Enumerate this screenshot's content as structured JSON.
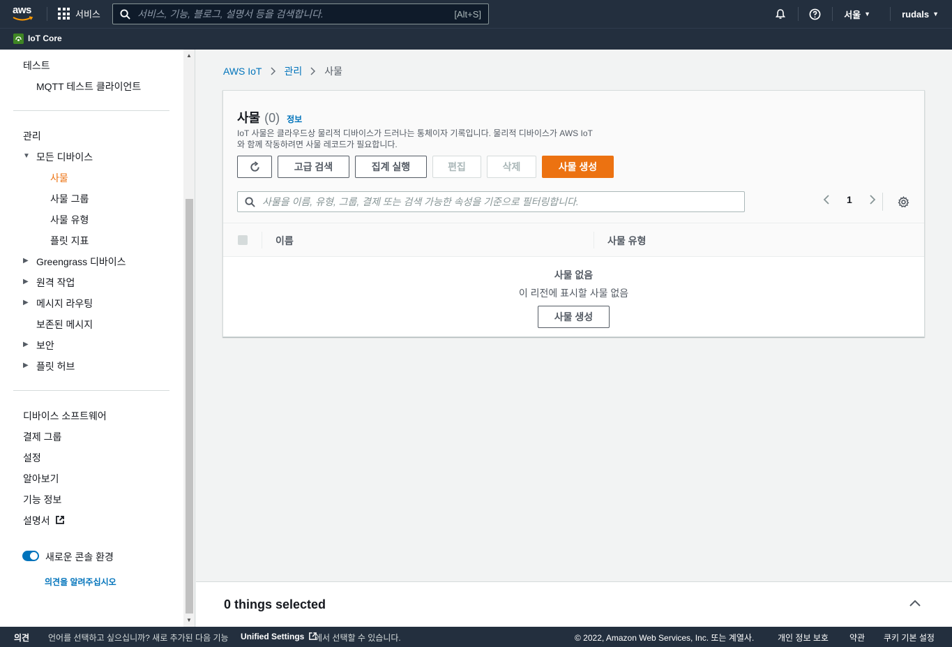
{
  "topnav": {
    "logo": "aws",
    "services_label": "서비스",
    "search_placeholder": "서비스, 기능, 블로그, 설명서 등을 검색합니다.",
    "search_shortcut": "[Alt+S]",
    "region": "서울",
    "user": "rudals"
  },
  "subnav": {
    "service": "IoT Core"
  },
  "sidebar": {
    "section_test": "테스트",
    "mqtt": "MQTT 테스트 클라이언트",
    "section_manage": "관리",
    "all_devices": "모든 디바이스",
    "things": "사물",
    "thing_groups": "사물 그룹",
    "thing_types": "사물 유형",
    "fleet_metrics": "플릿 지표",
    "greengrass": "Greengrass 디바이스",
    "remote": "원격 작업",
    "routing": "메시지 라우팅",
    "retained": "보존된 메시지",
    "security": "보안",
    "fleet_hub": "플릿 허브",
    "device_software": "디바이스 소프트웨어",
    "billing_groups": "결제 그룹",
    "settings": "설정",
    "learn": "알아보기",
    "feature_info": "기능 정보",
    "docs": "설명서",
    "new_console": "새로운 콘솔 환경",
    "feedback_link": "의견을 알려주십시오"
  },
  "breadcrumb": {
    "root": "AWS IoT",
    "manage": "관리",
    "current": "사물"
  },
  "panel": {
    "title": "사물",
    "count": "(0)",
    "info": "정보",
    "desc_line1": "IoT 사물은 클라우드상 물리적 디바이스가 드러나는 통체이자 기록입니다. 물리적 디바이스가 AWS IoT",
    "desc_line2": "와 함께 작동하려면 사물 레코드가 필요합니다.",
    "btn_advanced": "고급 검색",
    "btn_aggregate": "집계 실행",
    "btn_edit": "편집",
    "btn_delete": "삭제",
    "btn_create": "사물 생성",
    "filter_placeholder": "사물을 이름, 유형, 그룹, 결제 또는 검색 가능한 속성을 기준으로 필터링합니다.",
    "page": "1",
    "col_name": "이름",
    "col_type": "사물 유형",
    "empty_title": "사물 없음",
    "empty_sub": "이 리전에 표시할 사물 없음",
    "empty_btn": "사물 생성"
  },
  "selection": {
    "text": "0 things selected"
  },
  "footer": {
    "feedback": "의견",
    "lang_prefix": "언어를 선택하고 싶으십니까? 새로 추가된 다음 기능",
    "unified": "Unified Settings",
    "lang_suffix": "에서 선택할 수 있습니다.",
    "copyright": "© 2022, Amazon Web Services, Inc. 또는 계열사.",
    "privacy": "개인 정보 보호",
    "terms": "약관",
    "cookies": "쿠키 기본 설정"
  },
  "colors": {
    "nav_bg": "#232f3e",
    "accent": "#ec7211",
    "link": "#0073bb"
  }
}
